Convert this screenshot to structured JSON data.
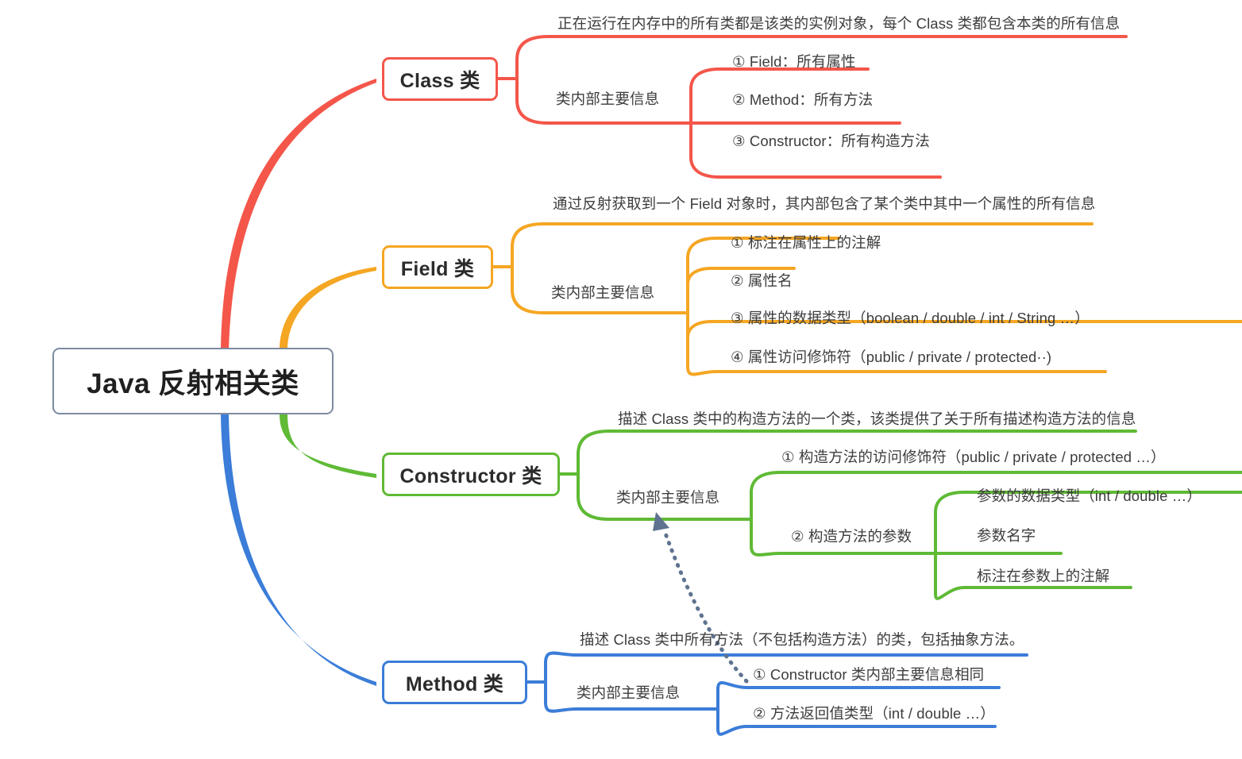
{
  "diagram": {
    "type": "mindmap",
    "title": "Java 反射相关类",
    "background": "#ffffff",
    "root": {
      "label": "Java 反射相关类",
      "border_color": "#7d8aa0"
    },
    "branches": [
      {
        "label": "Class 类",
        "color": "#f4564a",
        "description": "正在运行在内存中的所有类都是该类的实例对象，每个 Class 类都包含本类的所有信息",
        "group_label": "类内部主要信息",
        "items": [
          {
            "label": "① Field：所有属性"
          },
          {
            "label": "② Method：所有方法"
          },
          {
            "label": "③ Constructor：所有构造方法"
          }
        ]
      },
      {
        "label": "Field 类",
        "color": "#f5a623",
        "description": "通过反射获取到一个 Field 对象时，其内部包含了某个类中其中一个属性的所有信息",
        "group_label": "类内部主要信息",
        "items": [
          {
            "label": "① 标注在属性上的注解"
          },
          {
            "label": "② 属性名"
          },
          {
            "label": "③ 属性的数据类型（boolean / double / int / String …）"
          },
          {
            "label": "④ 属性访问修饰符（public / private / protected··)"
          }
        ]
      },
      {
        "label": "Constructor 类",
        "color": "#5fba35",
        "description": "描述 Class 类中的构造方法的一个类，该类提供了关于所有描述构造方法的信息",
        "group_label": "类内部主要信息",
        "items": [
          {
            "label": "① 构造方法的访问修饰符（public / private / protected …）"
          },
          {
            "label": "② 构造方法的参数",
            "children": [
              {
                "label": "参数的数据类型（int / double …）"
              },
              {
                "label": "参数名字"
              },
              {
                "label": "标注在参数上的注解"
              }
            ]
          }
        ]
      },
      {
        "label": "Method 类",
        "color": "#3b7dd8",
        "description": "描述 Class 类中所有方法（不包括构造方法）的类，包括抽象方法。",
        "group_label": "类内部主要信息",
        "items": [
          {
            "label": "① Constructor 类内部主要信息相同"
          },
          {
            "label": "② 方法返回值类型（int / double …）"
          }
        ]
      }
    ],
    "connector": {
      "name": "relationship-arrow",
      "style": "dotted-curved-arrow",
      "color": "#5f7390",
      "from": "method-item-1",
      "to": "constructor-group-label"
    }
  }
}
